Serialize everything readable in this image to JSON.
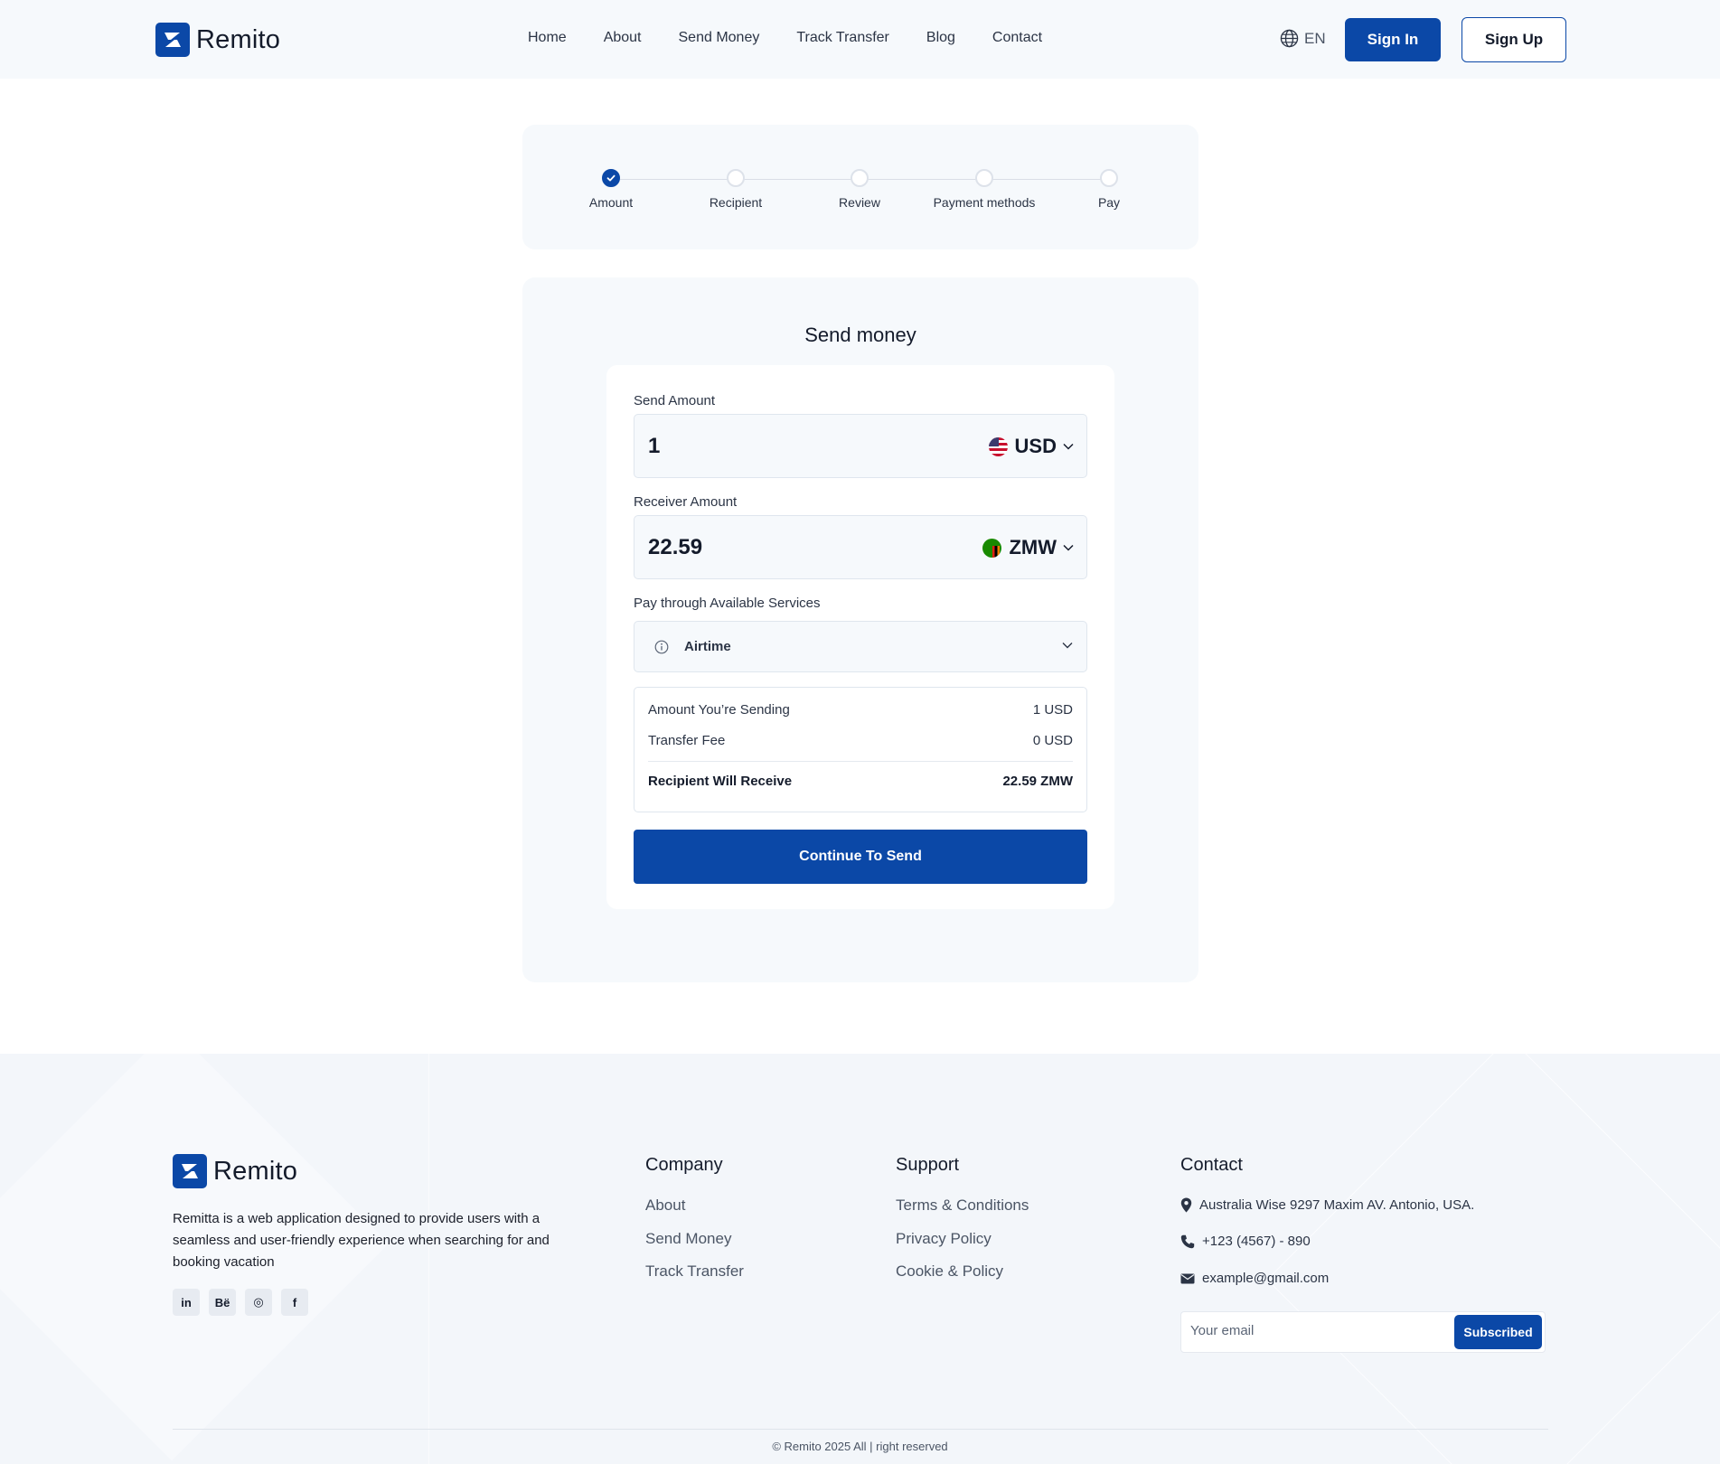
{
  "brand": {
    "name": "Remito"
  },
  "nav": {
    "items": [
      "Home",
      "About",
      "Send Money",
      "Track Transfer",
      "Blog",
      "Contact"
    ],
    "language": "EN",
    "sign_in": "Sign In",
    "sign_up": "Sign Up"
  },
  "stepper": {
    "steps": [
      {
        "label": "Amount",
        "done": true
      },
      {
        "label": "Recipient",
        "done": false
      },
      {
        "label": "Review",
        "done": false
      },
      {
        "label": "Payment methods",
        "done": false
      },
      {
        "label": "Pay",
        "done": false
      }
    ]
  },
  "send_form": {
    "title": "Send money",
    "send_amount": {
      "label": "Send Amount",
      "value": "1",
      "currency": "USD"
    },
    "receiver_amount": {
      "label": "Receiver Amount",
      "value": "22.59",
      "currency": "ZMW"
    },
    "service": {
      "label": "Pay through Available Services",
      "value": "Airtime"
    },
    "summary": {
      "sending_label": "Amount You’re Sending",
      "sending_value": "1 USD",
      "fee_label": "Transfer Fee",
      "fee_value": "0 USD",
      "receive_label": "Recipient Will Receive",
      "receive_value": "22.59 ZMW"
    },
    "continue_button": "Continue To Send"
  },
  "footer": {
    "description": "Remitta is a web application designed to provide users with a seamless and user-friendly experience when searching for and booking vacation",
    "socials": [
      {
        "icon": "linkedin-icon",
        "glyph": "in"
      },
      {
        "icon": "behance-icon",
        "glyph": "Bë"
      },
      {
        "icon": "instagram-icon",
        "glyph": "◎"
      },
      {
        "icon": "facebook-icon",
        "glyph": "f"
      }
    ],
    "company": {
      "title": "Company",
      "links": [
        "About",
        "Send Money",
        "Track Transfer"
      ]
    },
    "support": {
      "title": "Support",
      "links": [
        "Terms & Conditions",
        "Privacy Policy",
        "Cookie & Policy"
      ]
    },
    "contact": {
      "title": "Contact",
      "address": "Australia Wise 9297 Maxim AV. Antonio, USA.",
      "phone": "+123 (4567) - 890",
      "email": "example@gmail.com"
    },
    "subscribe": {
      "placeholder": "Your email",
      "button": "Subscribed"
    },
    "copyright": "© Remito 2025 All | right reserved"
  },
  "colors": {
    "primary": "#0b48a7",
    "surface": "#f6f9fc",
    "text": "#141b2b"
  }
}
